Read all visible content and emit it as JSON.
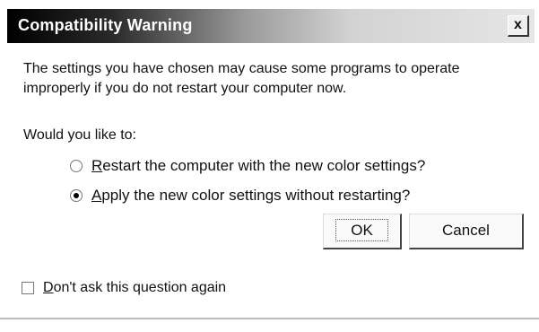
{
  "window": {
    "title": "Compatibility Warning",
    "close_glyph": "x"
  },
  "message": "The settings you have chosen may cause some programs to operate improperly if you do not restart your computer now.",
  "question": "Would you like to:",
  "options": [
    {
      "first": "R",
      "rest": "estart the computer with the new color settings?",
      "selected": false
    },
    {
      "first": "A",
      "rest": "pply the new color settings without restarting?",
      "selected": true
    }
  ],
  "buttons": {
    "ok": "OK",
    "cancel": "Cancel"
  },
  "checkbox": {
    "first": "D",
    "rest": "on't ask this question again",
    "checked": false
  }
}
